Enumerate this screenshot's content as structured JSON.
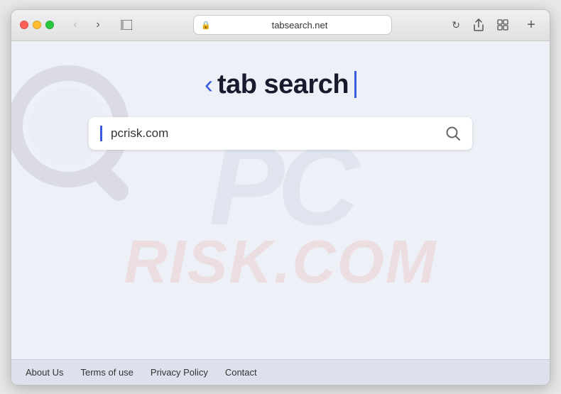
{
  "browser": {
    "url": "tabsearch.net",
    "url_display": "tabsearch.net",
    "back_enabled": false,
    "forward_enabled": false
  },
  "logo": {
    "chevron": "‹",
    "text": "tab search",
    "cursor": "|"
  },
  "search": {
    "placeholder": "pcrisk.com",
    "value": "pcrisk.com"
  },
  "footer": {
    "links": [
      {
        "label": "About Us",
        "id": "about-us"
      },
      {
        "label": "Terms of use",
        "id": "terms-of-use"
      },
      {
        "label": "Privacy Policy",
        "id": "privacy-policy"
      },
      {
        "label": "Contact",
        "id": "contact"
      }
    ]
  },
  "watermark": {
    "pc": "PC",
    "risk": "RISK.COM"
  }
}
